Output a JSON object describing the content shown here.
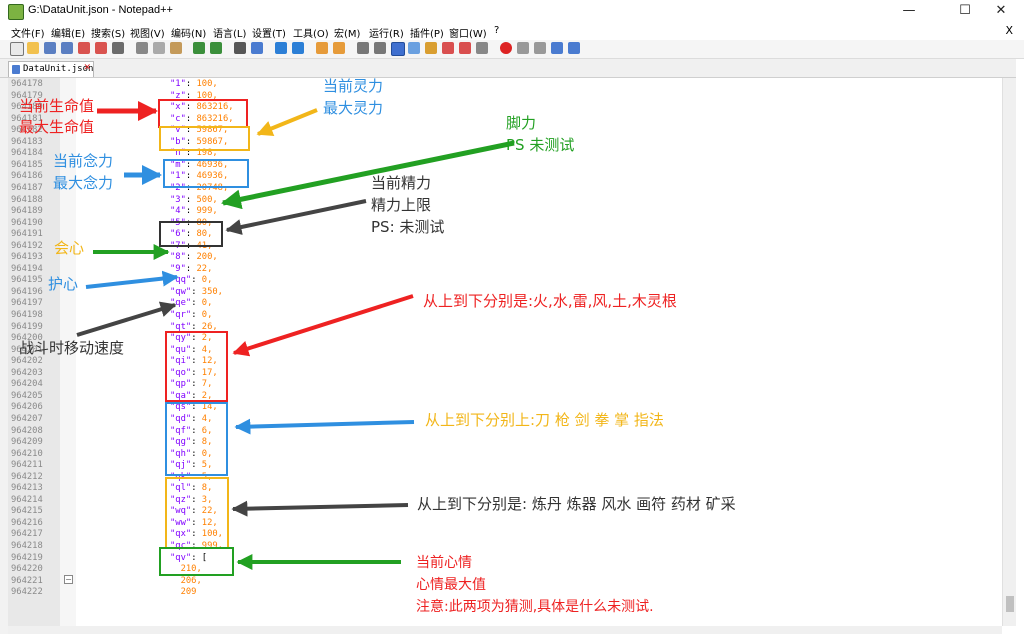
{
  "window": {
    "title": "G:\\DataUnit.json - Notepad++",
    "minimize": "—",
    "maximize": "☐",
    "close": "✕"
  },
  "menu": {
    "items": [
      "文件(F)",
      "编辑(E)",
      "搜索(S)",
      "视图(V)",
      "编码(N)",
      "语言(L)",
      "设置(T)",
      "工具(O)",
      "宏(M)",
      "运行(R)",
      "插件(P)",
      "窗口(W)",
      "?"
    ],
    "close": "X"
  },
  "tab": {
    "label": "DataUnit.json",
    "close": "✕"
  },
  "editor": {
    "lines": [
      {
        "num": "964178",
        "key": "\"1\"",
        "sep": ": ",
        "val": "100,"
      },
      {
        "num": "964179",
        "key": "\"z\"",
        "sep": ": ",
        "val": "100,"
      },
      {
        "num": "964180",
        "key": "\"x\"",
        "sep": ": ",
        "val": "863216,"
      },
      {
        "num": "964181",
        "key": "\"c\"",
        "sep": ": ",
        "val": "863216,"
      },
      {
        "num": "964182",
        "key": "\"v\"",
        "sep": ": ",
        "val": "59867,"
      },
      {
        "num": "964183",
        "key": "\"b\"",
        "sep": ": ",
        "val": "59867,"
      },
      {
        "num": "964184",
        "key": "\"n\"",
        "sep": ": ",
        "val": "198,"
      },
      {
        "num": "964185",
        "key": "\"m\"",
        "sep": ": ",
        "val": "46936,"
      },
      {
        "num": "964186",
        "key": "\"1\"",
        "sep": ": ",
        "val": "46936,"
      },
      {
        "num": "964187",
        "key": "\"2\"",
        "sep": ": ",
        "val": "20748,"
      },
      {
        "num": "964188",
        "key": "\"3\"",
        "sep": ": ",
        "val": "500,"
      },
      {
        "num": "964189",
        "key": "\"4\"",
        "sep": ": ",
        "val": "999,"
      },
      {
        "num": "964190",
        "key": "\"5\"",
        "sep": ": ",
        "val": "80,"
      },
      {
        "num": "964191",
        "key": "\"6\"",
        "sep": ": ",
        "val": "80,"
      },
      {
        "num": "964192",
        "key": "\"7\"",
        "sep": ": ",
        "val": "41,"
      },
      {
        "num": "964193",
        "key": "\"8\"",
        "sep": ": ",
        "val": "200,"
      },
      {
        "num": "964194",
        "key": "\"9\"",
        "sep": ": ",
        "val": "22,"
      },
      {
        "num": "964195",
        "key": "\"qq\"",
        "sep": ": ",
        "val": "0,"
      },
      {
        "num": "964196",
        "key": "\"qw\"",
        "sep": ": ",
        "val": "350,"
      },
      {
        "num": "964197",
        "key": "\"qe\"",
        "sep": ": ",
        "val": "0,"
      },
      {
        "num": "964198",
        "key": "\"qr\"",
        "sep": ": ",
        "val": "0,"
      },
      {
        "num": "964199",
        "key": "\"qt\"",
        "sep": ": ",
        "val": "26,"
      },
      {
        "num": "964200",
        "key": "\"qy\"",
        "sep": ": ",
        "val": "2,"
      },
      {
        "num": "964201",
        "key": "\"qu\"",
        "sep": ": ",
        "val": "4,"
      },
      {
        "num": "964202",
        "key": "\"qi\"",
        "sep": ": ",
        "val": "12,"
      },
      {
        "num": "964203",
        "key": "\"qo\"",
        "sep": ": ",
        "val": "17,"
      },
      {
        "num": "964204",
        "key": "\"qp\"",
        "sep": ": ",
        "val": "7,"
      },
      {
        "num": "964205",
        "key": "\"qa\"",
        "sep": ": ",
        "val": "2,"
      },
      {
        "num": "964206",
        "key": "\"qs\"",
        "sep": ": ",
        "val": "14,"
      },
      {
        "num": "964207",
        "key": "\"qd\"",
        "sep": ": ",
        "val": "4,"
      },
      {
        "num": "964208",
        "key": "\"qf\"",
        "sep": ": ",
        "val": "6,"
      },
      {
        "num": "964209",
        "key": "\"qg\"",
        "sep": ": ",
        "val": "8,"
      },
      {
        "num": "964210",
        "key": "\"qh\"",
        "sep": ": ",
        "val": "0,"
      },
      {
        "num": "964211",
        "key": "\"qj\"",
        "sep": ": ",
        "val": "5,"
      },
      {
        "num": "964212",
        "key": "\"qk\"",
        "sep": ": ",
        "val": "5,"
      },
      {
        "num": "964213",
        "key": "\"ql\"",
        "sep": ": ",
        "val": "8,"
      },
      {
        "num": "964214",
        "key": "\"qz\"",
        "sep": ": ",
        "val": "3,"
      },
      {
        "num": "964215",
        "key": "\"wq\"",
        "sep": ": ",
        "val": "22,"
      },
      {
        "num": "964216",
        "key": "\"ww\"",
        "sep": ": ",
        "val": "12,"
      },
      {
        "num": "964217",
        "key": "\"qx\"",
        "sep": ": ",
        "val": "100,"
      },
      {
        "num": "964218",
        "key": "\"qc\"",
        "sep": ": ",
        "val": "999,"
      },
      {
        "num": "964219",
        "key": "\"qv\"",
        "sep": ": ",
        "val": "["
      },
      {
        "num": "964220",
        "key": "",
        "sep": "",
        "val": "  210,"
      },
      {
        "num": "964221",
        "key": "",
        "sep": "",
        "val": "  206,"
      },
      {
        "num": "964222",
        "key": "",
        "sep": "",
        "val": "  209"
      }
    ]
  },
  "annotations": {
    "hp_current": "当前生命值",
    "hp_max": "最大生命值",
    "mp_current": "当前灵力",
    "mp_max": "最大灵力",
    "foot_title": "脚力",
    "foot_note": "PS 未测试",
    "mind_current": "当前念力",
    "mind_max": "最大念力",
    "energy_current": "当前精力",
    "energy_max": "精力上限",
    "energy_note": "PS: 未测试",
    "crit": "会心",
    "guard": "护心",
    "battle_speed": "战斗时移动速度",
    "spirit_roots": "从上到下分别是:火,水,雷,风,土,木灵根",
    "weapons": "从上到下分别上:刀 枪 剑 拳 掌 指法",
    "skills": "从上到下分别是: 炼丹 炼器 风水 画符 药材 矿采",
    "mood_current": "当前心情",
    "mood_max": "心情最大值",
    "mood_note": "注意:此两项为猜测,具体是什么未测试."
  },
  "colors": {
    "red": "#ee2222",
    "orange": "#f2b619",
    "green": "#22a022",
    "blue": "#2f8fe0",
    "dark": "#444444"
  }
}
